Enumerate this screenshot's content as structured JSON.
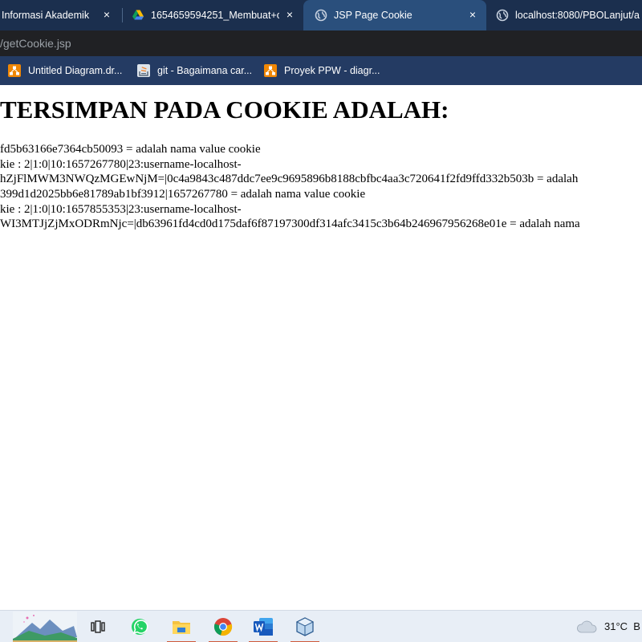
{
  "browser": {
    "tabs": [
      {
        "title": "Informasi Akademik",
        "close": "×"
      },
      {
        "title": "1654659594251_Membuat+c",
        "close": "×"
      },
      {
        "title": "JSP Page Cookie",
        "close": "×"
      },
      {
        "title": "localhost:8080/PBOLanjut/a"
      }
    ],
    "address": "/getCookie.jsp",
    "bookmarks": [
      {
        "label": "Untitled Diagram.dr..."
      },
      {
        "label": "git - Bagaimana car..."
      },
      {
        "label": "Proyek PPW - diagr..."
      }
    ]
  },
  "page": {
    "heading": "TERSIMPAN PADA COOKIE ADALAH:",
    "lines": [
      "fd5b63166e7364cb50093 = adalah nama value cookie",
      "kie : 2|1:0|10:1657267780|23:username-localhost-",
      "hZjFlMWM3NWQzMGEwNjM=|0c4a9843c487ddc7ee9c9695896b8188cbfbc4aa3c720641f2fd9ffd332b503b = adalah",
      "399d1d2025bb6e81789ab1bf3912|1657267780 = adalah nama value cookie",
      "kie : 2|1:0|10:1657855353|23:username-localhost-",
      "WI3MTJjZjMxODRmNjc=|db63961fd4cd0d175daf6f87197300df314afc3415c3b64b246967956268e01e = adalah nama"
    ]
  },
  "taskbar": {
    "temperature": "31°C",
    "weather_suffix": "B",
    "apps": [
      "landscape-widget",
      "task-view-icon",
      "whatsapp-icon",
      "file-explorer-icon",
      "chrome-icon",
      "word-icon",
      "virtualbox-icon"
    ]
  },
  "colors": {
    "tabstrip": "#1b2f4e",
    "active_tab": "#2a4f7c",
    "address_bar": "#202124",
    "bookmarks_bar": "#243b63",
    "taskbar": "#e8eef6"
  }
}
